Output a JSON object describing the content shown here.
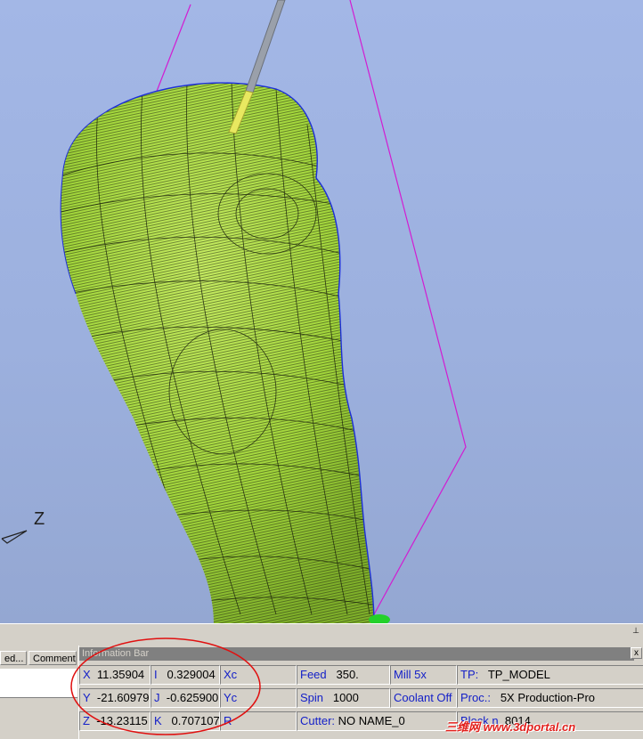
{
  "viewport": {
    "axis_label": "Z"
  },
  "tabs": [
    {
      "label": "ed..."
    },
    {
      "label": "Comment"
    }
  ],
  "info_bar": {
    "title": "Information Bar",
    "close_glyph": "x",
    "pin_glyph": "⊥",
    "coords": {
      "x": {
        "label": "X",
        "value": "11.35904"
      },
      "y": {
        "label": "Y",
        "value": "-21.60979"
      },
      "z": {
        "label": "Z",
        "value": "-13.23115"
      }
    },
    "vectors": {
      "i": {
        "label": "I",
        "value": "0.329004"
      },
      "j": {
        "label": "J",
        "value": "-0.625900"
      },
      "k": {
        "label": "K",
        "value": "0.707107"
      }
    },
    "center": {
      "xc": {
        "label": "Xc"
      },
      "yc": {
        "label": "Yc"
      },
      "r": {
        "label": "R"
      }
    },
    "feed": {
      "label": "Feed",
      "value": "350."
    },
    "spin": {
      "label": "Spin",
      "value": "1000"
    },
    "cutter": {
      "label": "Cutter:",
      "value": "NO NAME_0"
    },
    "mill_mode": {
      "label": "Mill 5x"
    },
    "coolant": {
      "label": "Coolant Off"
    },
    "tp": {
      "label": "TP:",
      "value": "TP_MODEL"
    },
    "proc": {
      "label": "Proc.:",
      "value": "5X Production-Pro"
    },
    "block": {
      "label": "Block n",
      "value": "8014"
    }
  },
  "watermark": "三维网 www.3dportal.cn",
  "colors": {
    "mesh_fill": "#a6de3e",
    "mesh_lines": "#1e2a10",
    "tool_path": "#d21cd2",
    "annotation": "#e01010"
  }
}
